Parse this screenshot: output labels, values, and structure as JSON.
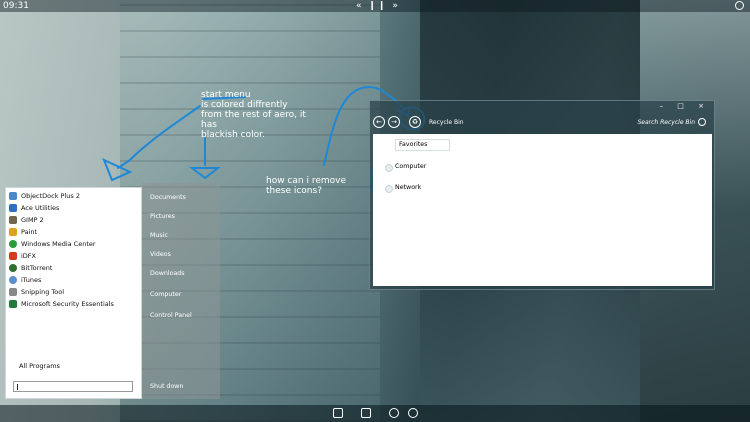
{
  "top_bar": {
    "clock": "09:31",
    "media": {
      "prev": "«",
      "pause": "❙❙",
      "next": "»"
    },
    "tray_icon": "clock-circle-icon"
  },
  "annotations": {
    "note1": "start menu\nis colored diffrently\nfrom the rest of aero, it has\nblackish color.",
    "note2": "how can i remove\nthese icons?"
  },
  "start_menu": {
    "programs": [
      {
        "label": "ObjectDock Plus 2",
        "color": "#4a86c8"
      },
      {
        "label": "Ace Utilities",
        "color": "#2b6fbf"
      },
      {
        "label": "GIMP 2",
        "color": "#6f6650"
      },
      {
        "label": "Paint",
        "color": "#e0a020"
      },
      {
        "label": "Windows Media Center",
        "color": "#2a9d3a"
      },
      {
        "label": "iDFX",
        "color": "#d23a1a"
      },
      {
        "label": "BitTorrent",
        "color": "#2d6e2d"
      },
      {
        "label": "iTunes",
        "color": "#5b8fd0"
      },
      {
        "label": "Snipping Tool",
        "color": "#888888"
      },
      {
        "label": "Microsoft Security Essentials",
        "color": "#1f7a3a"
      }
    ],
    "all_programs": "All Programs",
    "search_placeholder": "",
    "right_links": [
      "Documents",
      "Pictures",
      "Music",
      "Videos",
      "Downloads",
      "Computer",
      "Control Panel"
    ],
    "shutdown": "Shut down"
  },
  "explorer": {
    "address": "Recycle Bin",
    "search_placeholder": "Search Recycle Bin",
    "caption_buttons": "– □ ×",
    "favorites": "Favorites",
    "nav_items": [
      "Computer",
      "Network"
    ]
  },
  "taskbar": {
    "items": [
      "explorer-icon",
      "grid-icon",
      "chrome-icon",
      "globe-icon"
    ]
  }
}
